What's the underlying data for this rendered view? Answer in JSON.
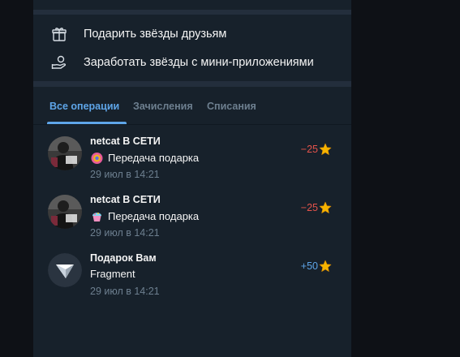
{
  "actions": [
    {
      "label": "Подарить звёзды друзьям",
      "icon": "gift-icon"
    },
    {
      "label": "Заработать звёзды с мини-приложениями",
      "icon": "hand-coin-icon"
    }
  ],
  "tabs": [
    {
      "label": "Все операции",
      "active": true
    },
    {
      "label": "Зачисления",
      "active": false
    },
    {
      "label": "Списания",
      "active": false
    }
  ],
  "transactions": [
    {
      "title": "netcat В СЕТИ",
      "subtitle": "Передача подарка",
      "date": "29 июл в 14:21",
      "amount": "−25",
      "kind": "negative",
      "emoji": "gift-ball-icon"
    },
    {
      "title": "netcat В СЕТИ",
      "subtitle": "Передача подарка",
      "date": "29 июл в 14:21",
      "amount": "−25",
      "kind": "negative",
      "emoji": "cupcake-icon"
    },
    {
      "title": "Подарок Вам",
      "subtitle": "Fragment",
      "date": "29 июл в 14:21",
      "amount": "+50",
      "kind": "positive",
      "emoji": "fragment-logo"
    }
  ],
  "colors": {
    "accent": "#5ea5e8",
    "negative": "#e5534b",
    "panel": "#17212b",
    "star": "#f5b400"
  }
}
